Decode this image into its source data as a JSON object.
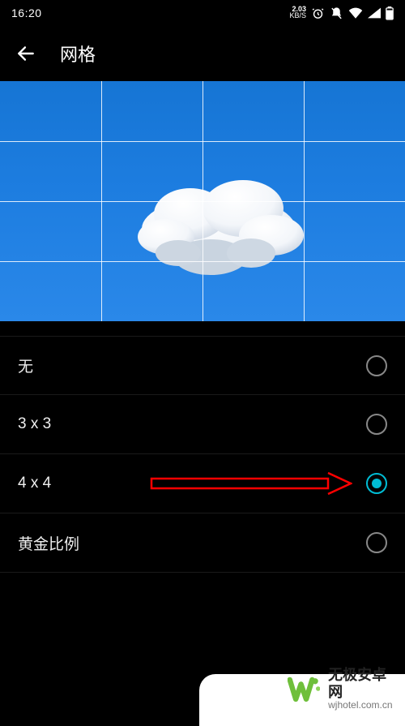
{
  "status": {
    "time": "16:20",
    "netSpeedTop": "2.03",
    "netSpeedBot": "KB/S"
  },
  "header": {
    "title": "网格"
  },
  "options": {
    "items": [
      {
        "label": "无",
        "selected": false
      },
      {
        "label": "3 x 3",
        "selected": false
      },
      {
        "label": "4 x 4",
        "selected": true
      },
      {
        "label": "黄金比例",
        "selected": false
      }
    ]
  },
  "watermark": {
    "title": "无极安卓网",
    "url": "wjhotel.com.cn"
  }
}
